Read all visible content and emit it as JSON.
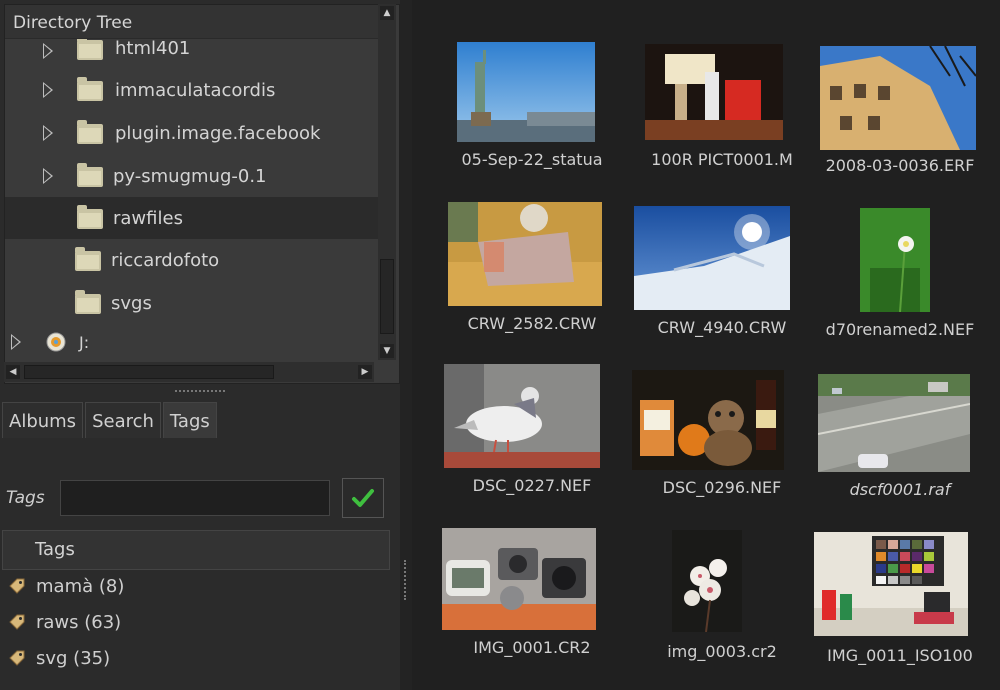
{
  "directory_tree": {
    "title": "Directory Tree",
    "rows": [
      {
        "label": "html401",
        "expandable": true,
        "selected": false,
        "icon": "folder-icon"
      },
      {
        "label": "immaculatacordis",
        "expandable": true,
        "selected": false,
        "icon": "folder-icon"
      },
      {
        "label": "plugin.image.facebook",
        "expandable": true,
        "selected": false,
        "icon": "folder-icon"
      },
      {
        "label": "py-smugmug-0.1",
        "expandable": true,
        "selected": false,
        "icon": "folder-icon"
      },
      {
        "label": "rawfiles",
        "expandable": false,
        "selected": true,
        "icon": "folder-icon"
      },
      {
        "label": "riccardofoto",
        "expandable": false,
        "selected": false,
        "icon": "folder-icon"
      },
      {
        "label": "svgs",
        "expandable": false,
        "selected": false,
        "icon": "folder-icon"
      },
      {
        "label": "J:",
        "expandable": true,
        "selected": false,
        "icon": "drive-icon"
      }
    ]
  },
  "tabs": [
    {
      "label": "Albums",
      "active": false
    },
    {
      "label": "Search",
      "active": false
    },
    {
      "label": "Tags",
      "active": true
    }
  ],
  "tags_panel": {
    "field_label": "Tags",
    "input_value": "",
    "apply_icon": "checkmark-icon",
    "column_header": "Tags",
    "items": [
      {
        "label": "mamà (8)"
      },
      {
        "label": "raws (63)"
      },
      {
        "label": "svg (35)"
      }
    ]
  },
  "thumbnails": [
    {
      "caption": "05-Sep-22_statua",
      "italic": false,
      "subject": "statue-of-liberty"
    },
    {
      "caption": "100R PICT0001.M",
      "italic": false,
      "subject": "shelf-objects"
    },
    {
      "caption": "2008-03-0036.ERF",
      "italic": false,
      "subject": "building"
    },
    {
      "caption": "CRW_2582.CRW",
      "italic": false,
      "subject": "banknote"
    },
    {
      "caption": "CRW_4940.CRW",
      "italic": false,
      "subject": "snow-sun"
    },
    {
      "caption": "d70renamed2.NEF",
      "italic": false,
      "subject": "flower-green"
    },
    {
      "caption": "DSC_0227.NEF",
      "italic": false,
      "subject": "pigeon"
    },
    {
      "caption": "DSC_0296.NEF",
      "italic": false,
      "subject": "teddy-bear"
    },
    {
      "caption": "dscf0001.raf",
      "italic": true,
      "subject": "street"
    },
    {
      "caption": "IMG_0001.CR2",
      "italic": false,
      "subject": "cameras"
    },
    {
      "caption": "img_0003.cr2",
      "italic": false,
      "subject": "white-flowers"
    },
    {
      "caption": "IMG_0011_ISO100",
      "italic": false,
      "subject": "color-chart"
    }
  ],
  "colors": {
    "panel": "#3a3a3a",
    "background": "#202020",
    "accent_check": "#3fbf3f",
    "tag_icon": "#d8b87a"
  }
}
